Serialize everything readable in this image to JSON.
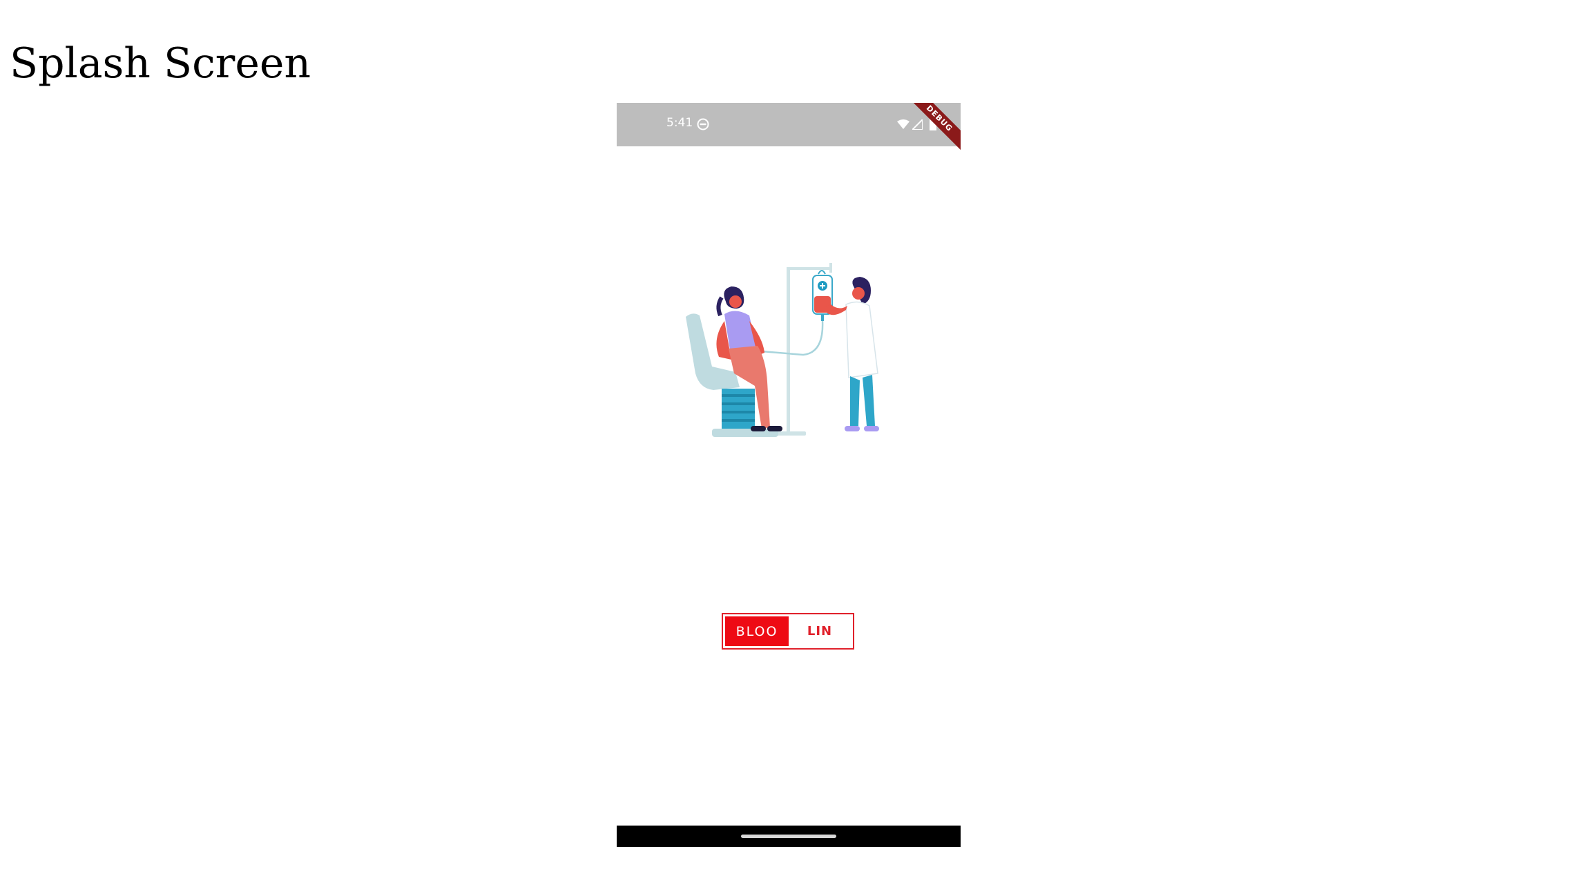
{
  "page": {
    "title": "Splash Screen"
  },
  "status_bar": {
    "time": "5:41",
    "icons": [
      "do-not-disturb-icon",
      "wifi-icon",
      "signal-icon",
      "battery-icon"
    ],
    "background": "#bdbdbd"
  },
  "debug_banner": {
    "label": "DEBUG",
    "color": "#8b1a1a"
  },
  "illustration": {
    "subject": "blood-donation-illustration"
  },
  "logo": {
    "left_text": "BLOO",
    "right_text": "LIN",
    "accent": "#ee0a14"
  },
  "nav_bar": {
    "color": "#000000"
  }
}
